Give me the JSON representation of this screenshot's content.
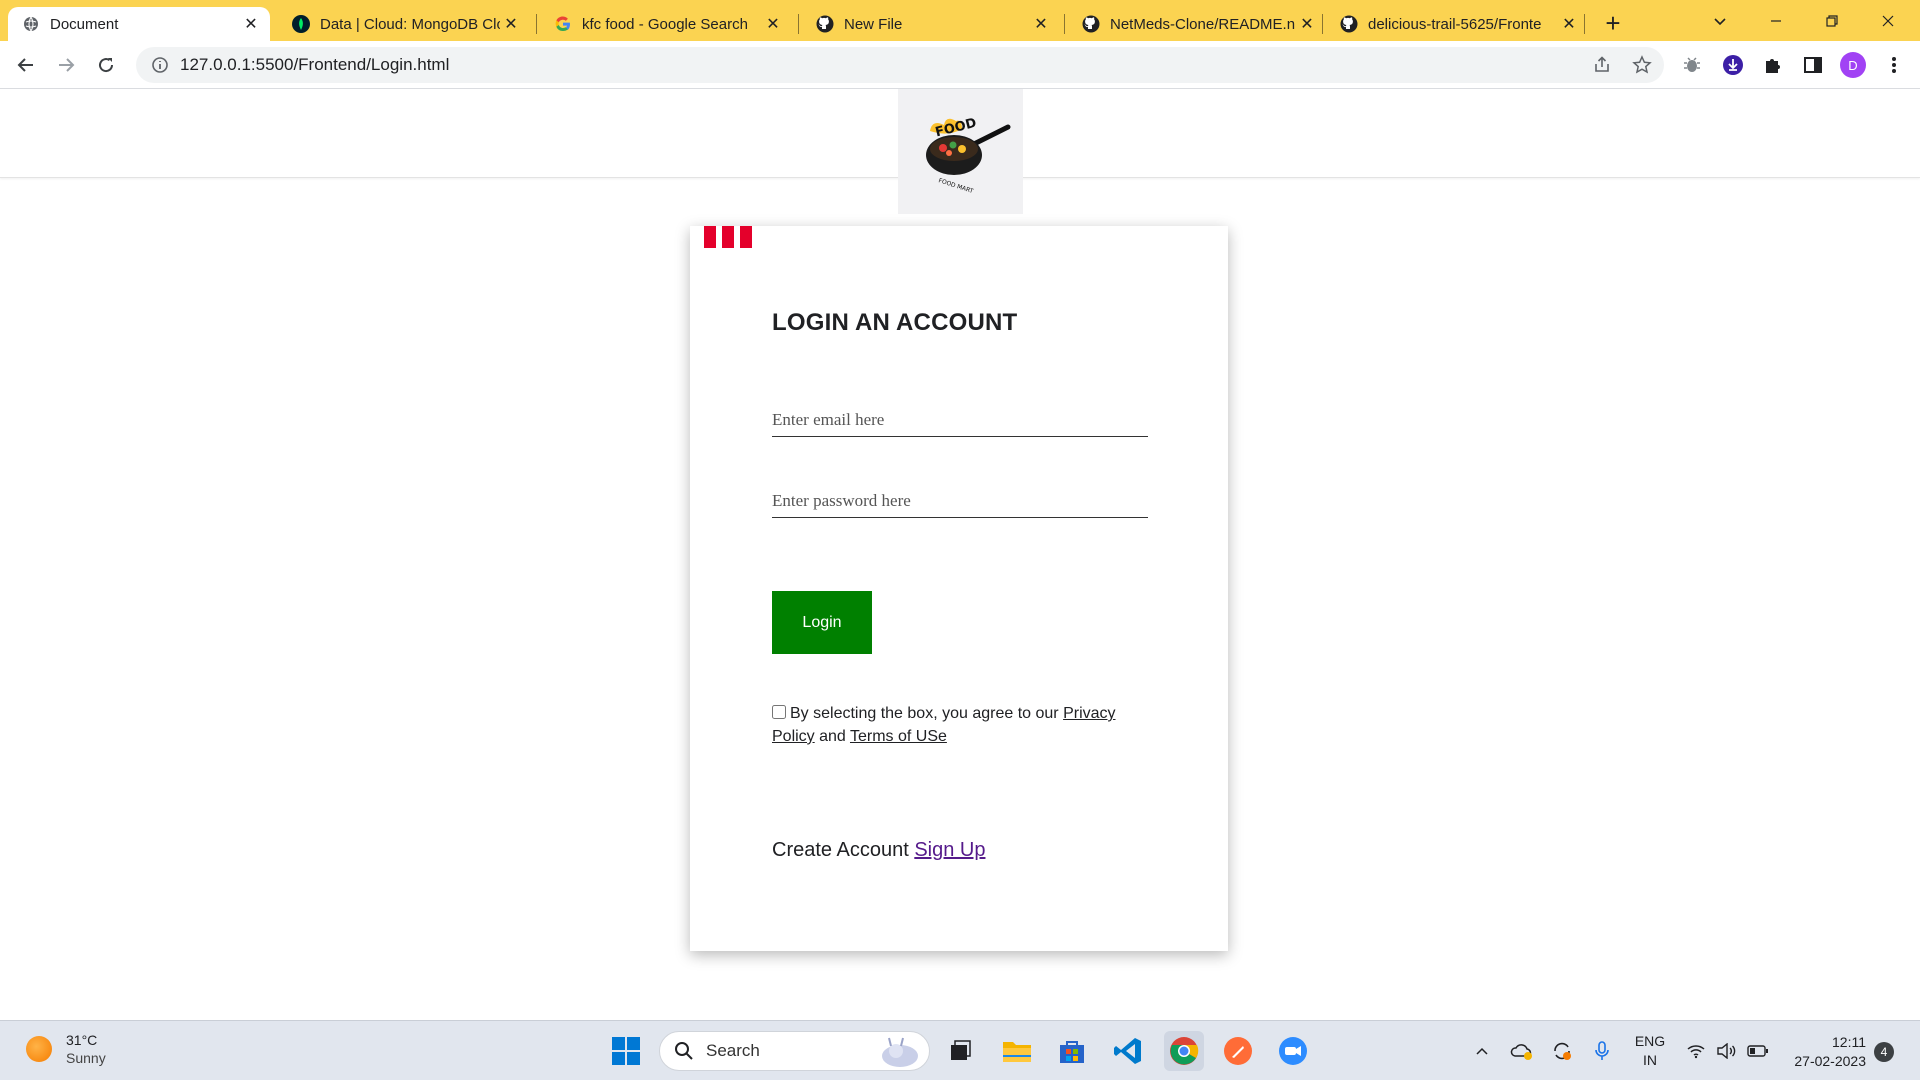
{
  "browser": {
    "tabs": [
      {
        "title": "Document",
        "icon": "globe-icon",
        "active": true
      },
      {
        "title": "Data | Cloud: MongoDB Clo",
        "icon": "mongodb-leaf-icon"
      },
      {
        "title": "kfc food - Google Search",
        "icon": "google-icon"
      },
      {
        "title": "New File",
        "icon": "github-icon"
      },
      {
        "title": "NetMeds-Clone/README.n",
        "icon": "github-icon"
      },
      {
        "title": "delicious-trail-5625/Fronte",
        "icon": "github-icon"
      }
    ],
    "url": "127.0.0.1:5500/Frontend/Login.html",
    "profile_initial": "D"
  },
  "site": {
    "logo_text": "FOOD",
    "logo_subtext": "FOOD MART"
  },
  "login": {
    "heading": "LOGIN AN ACCOUNT",
    "email_placeholder": "Enter email here",
    "password_placeholder": "Enter password here",
    "button_label": "Login",
    "agree_prefix": "By selecting the box, you agree to our ",
    "privacy_link": "Privacy Policy",
    "agree_and": " and ",
    "terms_link": "Terms of USe",
    "create_text": "Create Account ",
    "signup_link": "Sign Up",
    "accent_color": "#e4002b",
    "button_color": "#008000"
  },
  "taskbar": {
    "weather_temp": "31°C",
    "weather_desc": "Sunny",
    "search_label": "Search",
    "lang_top": "ENG",
    "lang_bottom": "IN",
    "time": "12:11",
    "date": "27-02-2023",
    "notification_count": "4"
  }
}
